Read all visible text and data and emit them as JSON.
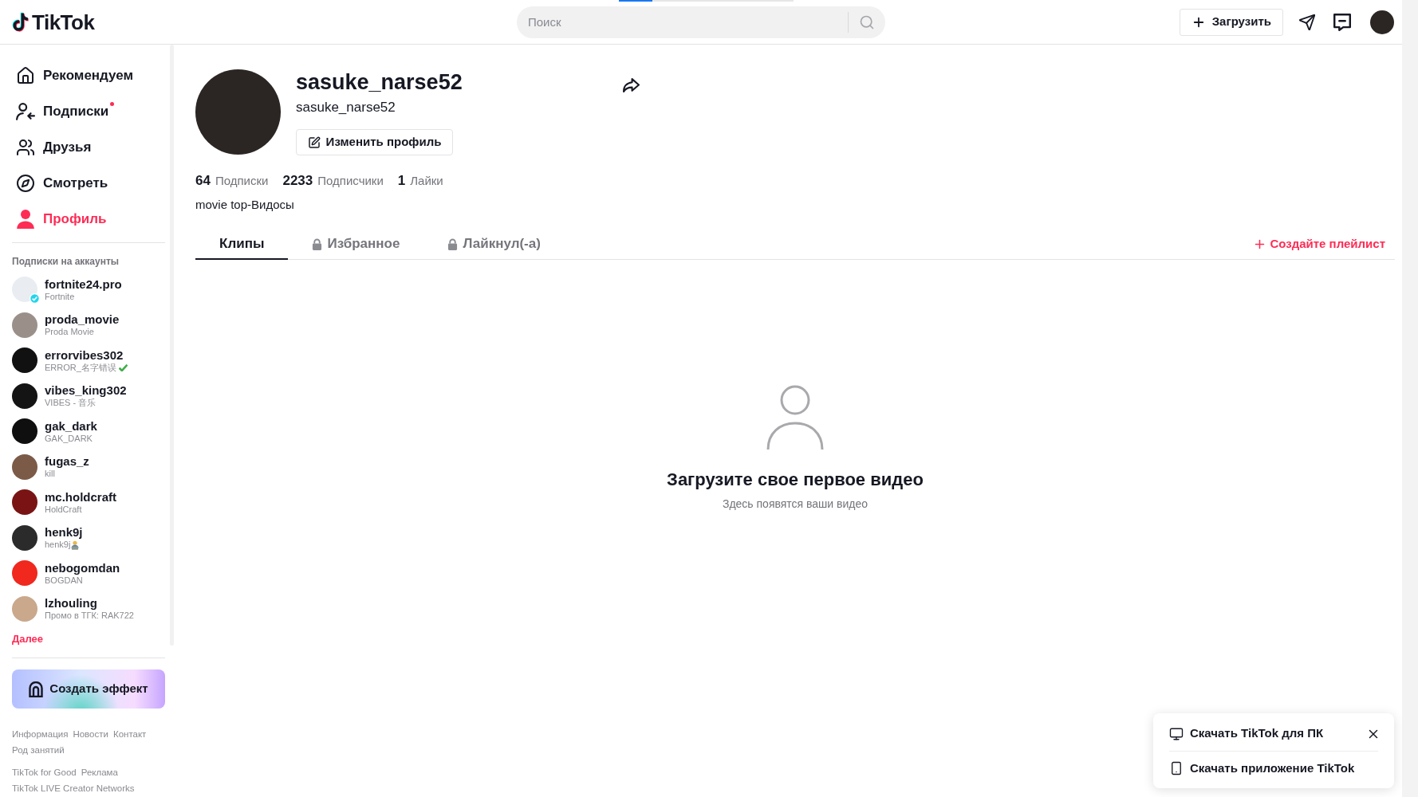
{
  "header": {
    "logo": "TikTok",
    "loading_bar": {
      "level": 0.19
    },
    "search": {
      "placeholder": "Поиск"
    },
    "upload_button": "Загрузить"
  },
  "sidebar": {
    "nav": [
      {
        "label": "Рекомендуем",
        "selected": false,
        "dot": false
      },
      {
        "label": "Подписки",
        "selected": false,
        "dot": true
      },
      {
        "label": "Друзья",
        "selected": false,
        "dot": false
      },
      {
        "label": "Смотреть",
        "selected": false,
        "dot": false
      },
      {
        "label": "Профиль",
        "selected": true,
        "dot": false
      }
    ],
    "following_title": "Подписки на аккаунты",
    "accounts": [
      {
        "kind": "plain",
        "name": "fortnite24.pro",
        "nickname": "Fortnite",
        "verified": true,
        "color": "#e9edf2"
      },
      {
        "kind": "plain",
        "name": "proda_movie",
        "nickname": "Proda Movie",
        "verified": false,
        "color": "#9b9089"
      },
      {
        "kind": "check",
        "name": "errorvibes302",
        "nickname": "ERROR_名字错误",
        "verified": false,
        "color": "#111111"
      },
      {
        "kind": "plain",
        "name": "vibes_king302",
        "nickname": "VIBES - 音乐",
        "verified": false,
        "color": "#141414"
      },
      {
        "kind": "plain",
        "name": "gak_dark",
        "nickname": "GAK_DARK",
        "verified": false,
        "color": "#0f0f0f"
      },
      {
        "kind": "plain",
        "name": "fugas_z",
        "nickname": "kill",
        "verified": false,
        "color": "#7b5a47"
      },
      {
        "kind": "plain",
        "name": "mc.holdcraft",
        "nickname": "HoldCraft",
        "verified": false,
        "color": "#7a1414"
      },
      {
        "kind": "technologist",
        "name": "henk9j",
        "nickname": "henk9j",
        "verified": false,
        "color": "#2b2b2b"
      },
      {
        "kind": "plain",
        "name": "nebogomdan",
        "nickname": "BOGDAN",
        "verified": false,
        "color": "#f0281e"
      },
      {
        "kind": "plain",
        "name": "lzhouling",
        "nickname": "Промо в ТГК: RAK722",
        "verified": false,
        "color": "#c9a88c"
      }
    ],
    "more_link": "Далее",
    "effect_button": "Создать эффект",
    "footer_groups": [
      [
        "Информация",
        "Новости",
        "Контакт",
        "Род занятий"
      ],
      [
        "TikTok for Good",
        "Реклама",
        "TikTok LIVE Creator Networks"
      ]
    ]
  },
  "profile": {
    "username": "sasuke_narse52",
    "handle": "sasuke_narse52",
    "edit_button": "Изменить профиль",
    "stats": [
      {
        "count": "64",
        "unit": "Подписки"
      },
      {
        "count": "2233",
        "unit": "Подписчики"
      },
      {
        "count": "1",
        "unit": "Лайки"
      }
    ],
    "bio": "movie top-Видосы"
  },
  "tabs": [
    {
      "label": "Клипы",
      "selected": true,
      "locked": false
    },
    {
      "label": "Избранное",
      "selected": false,
      "locked": true
    },
    {
      "label": "Лайкнул(-а)",
      "selected": false,
      "locked": true
    }
  ],
  "create_playlist": "Создайте плейлист",
  "empty_state": {
    "title": "Загрузите свое первое видео",
    "subtitle": "Здесь появятся ваши видео"
  },
  "download_popup": {
    "items": [
      {
        "kind": "desktop",
        "label": "Скачать TikTok для ПК"
      },
      {
        "kind": "phone",
        "label": "Скачать приложение TikTok"
      }
    ]
  }
}
